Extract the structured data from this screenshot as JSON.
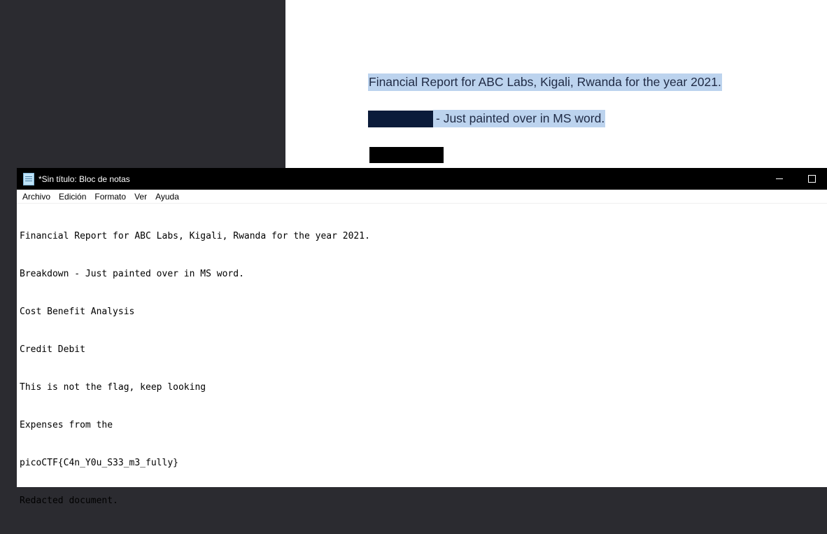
{
  "document": {
    "title_line": "Financial Report for ABC Labs, Kigali, Rwanda for the year 2021.",
    "line2_text": " - Just painted over in MS word."
  },
  "notepad": {
    "window_title": "*Sin título: Bloc de notas",
    "menu": [
      "Archivo",
      "Edición",
      "Formato",
      "Ver",
      "Ayuda"
    ],
    "lines": [
      "Financial Report for ABC Labs, Kigali, Rwanda for the year 2021.",
      "Breakdown - Just painted over in MS word.",
      "Cost Benefit Analysis",
      "Credit Debit",
      "This is not the flag, keep looking",
      "Expenses from the",
      "picoCTF{C4n_Y0u_S33_m3_fully}",
      "Redacted document."
    ]
  },
  "colors": {
    "selection": "#bcd3ee",
    "redaction_navy": "#0b1b3a",
    "redaction_black": "#000000",
    "titlebar": "#000000"
  }
}
